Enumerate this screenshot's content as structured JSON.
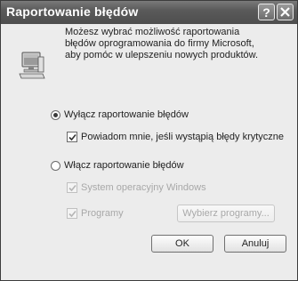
{
  "window": {
    "title": "Raportowanie błędów",
    "help_glyph": "?",
    "close_glyph": "X"
  },
  "intro": {
    "line1": "Możesz wybrać możliwość raportowania",
    "line2": "błędów oprogramowania do firmy Microsoft,",
    "line3": "aby pomóc w ulepszeniu nowych produktów."
  },
  "options": {
    "disable_label": "Wyłącz raportowanie błędów",
    "disable_selected": true,
    "notify_label": "Powiadom mnie, jeśli wystąpią błędy krytyczne",
    "notify_checked": true,
    "enable_label": "Włącz raportowanie błędów",
    "enable_selected": false,
    "os_label": "System operacyjny Windows",
    "os_checked": true,
    "programs_label": "Programy",
    "programs_checked": true,
    "choose_programs_label": "Wybierz programy..."
  },
  "buttons": {
    "ok": "OK",
    "cancel": "Anuluj"
  }
}
